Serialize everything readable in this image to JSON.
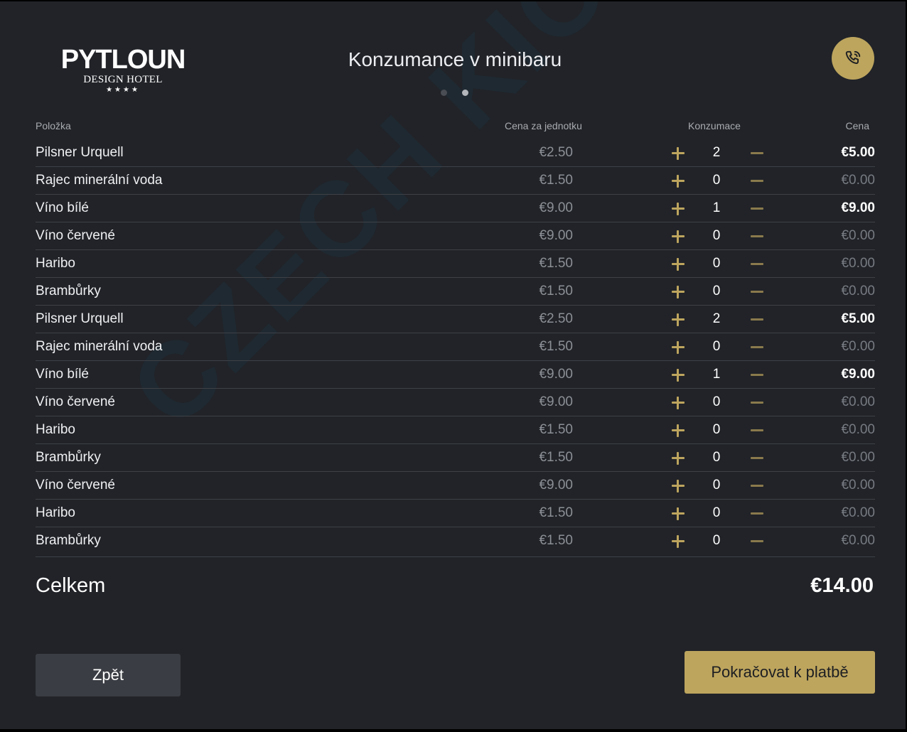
{
  "logo": {
    "name": "PYTLOUN",
    "subtitle": "DESIGN HOTEL",
    "stars": "★★★★"
  },
  "header": {
    "title": "Konzumance v minibaru"
  },
  "pager": {
    "pages": 2,
    "active": 2
  },
  "watermark": "CZECH KIOSK",
  "columns": {
    "item": "Položka",
    "unit_price": "Cena za jednotku",
    "consumption": "Konzumace",
    "price": "Cena"
  },
  "items": [
    {
      "name": "Pilsner Urquell",
      "unit_price": "€2.50",
      "qty": "2",
      "price": "€5.00"
    },
    {
      "name": "Rajec minerální voda",
      "unit_price": "€1.50",
      "qty": "0",
      "price": "€0.00"
    },
    {
      "name": "Víno bílé",
      "unit_price": "€9.00",
      "qty": "1",
      "price": "€9.00"
    },
    {
      "name": "Víno červené",
      "unit_price": "€9.00",
      "qty": "0",
      "price": "€0.00"
    },
    {
      "name": "Haribo",
      "unit_price": "€1.50",
      "qty": "0",
      "price": "€0.00"
    },
    {
      "name": "Brambůrky",
      "unit_price": "€1.50",
      "qty": "0",
      "price": "€0.00"
    },
    {
      "name": "Pilsner Urquell",
      "unit_price": "€2.50",
      "qty": "2",
      "price": "€5.00"
    },
    {
      "name": "Rajec minerální voda",
      "unit_price": "€1.50",
      "qty": "0",
      "price": "€0.00"
    },
    {
      "name": "Víno bílé",
      "unit_price": "€9.00",
      "qty": "1",
      "price": "€9.00"
    },
    {
      "name": "Víno červené",
      "unit_price": "€9.00",
      "qty": "0",
      "price": "€0.00"
    },
    {
      "name": "Haribo",
      "unit_price": "€1.50",
      "qty": "0",
      "price": "€0.00"
    },
    {
      "name": "Brambůrky",
      "unit_price": "€1.50",
      "qty": "0",
      "price": "€0.00"
    },
    {
      "name": "Víno červené",
      "unit_price": "€9.00",
      "qty": "0",
      "price": "€0.00"
    },
    {
      "name": "Haribo",
      "unit_price": "€1.50",
      "qty": "0",
      "price": "€0.00"
    },
    {
      "name": "Brambůrky",
      "unit_price": "€1.50",
      "qty": "0",
      "price": "€0.00"
    }
  ],
  "total": {
    "label": "Celkem",
    "value": "€14.00"
  },
  "buttons": {
    "back": "Zpět",
    "pay": "Pokračovat k platbě"
  },
  "icons": {
    "call": "phone-call-icon",
    "increase": "plus-icon",
    "decrease": "minus-icon"
  },
  "colors": {
    "accent": "#bda55e",
    "background": "#212328",
    "secondary_button": "#3a3d43"
  }
}
